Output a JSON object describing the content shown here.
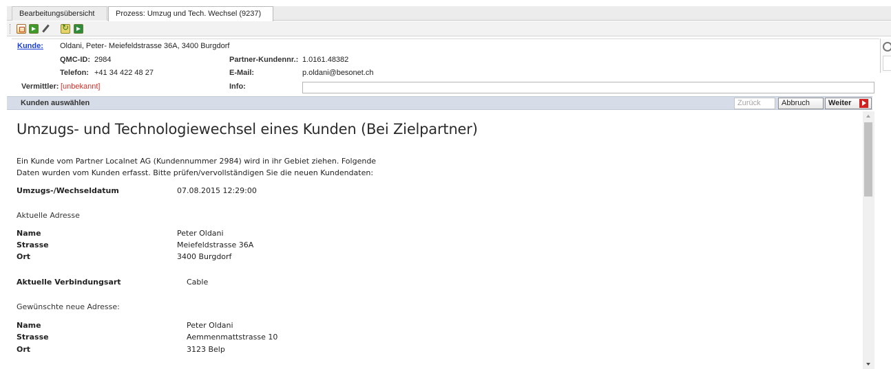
{
  "tabs": [
    {
      "label": "Bearbeitungsübersicht"
    },
    {
      "label": "Prozess: Umzug und Tech. Wechsel (9237)"
    }
  ],
  "toolbar": {
    "icons": [
      "edit-form-icon",
      "import-icon",
      "pencil-icon",
      "refresh-icon",
      "export-icon"
    ]
  },
  "customer": {
    "kunde_label": "Kunde:",
    "kunde_value": "Oldani, Peter- Meiefeldstrasse 36A, 3400 Burgdorf",
    "qmc_label": "QMC-ID:",
    "qmc_value": "2984",
    "telefon_label": "Telefon:",
    "telefon_value": "+41 34 422 48 27",
    "vermittler_label": "Vermittler:",
    "vermittler_value": "[unbekannt]",
    "partner_label": "Partner-Kundennr.:",
    "partner_value": "1.0161.48382",
    "email_label": "E-Mail:",
    "email_value": "p.oldani@besonet.ch",
    "info_label": "Info:",
    "info_value": ""
  },
  "actionbar": {
    "title": "Kunden auswählen",
    "zurueck": "Zurück",
    "abbruch": "Abbruch",
    "weiter": "Weiter"
  },
  "content": {
    "heading": "Umzugs- und Technologiewechsel eines Kunden (Bei Zielpartner)",
    "intro_line1": "Ein Kunde vom Partner Localnet AG (Kundennummer 2984) wird in ihr Gebiet ziehen. Folgende",
    "intro_line2": "Daten wurden vom Kunden erfasst. Bitte prüfen/vervollständigen Sie die neuen Kundendaten:",
    "datum_label": "Umzugs-/Wechseldatum",
    "datum_value": "07.08.2015 12:29:00",
    "current_section": "Aktuelle Adresse",
    "current": {
      "name_label": "Name",
      "name_value": "Peter Oldani",
      "strasse_label": "Strasse",
      "strasse_value": "Meiefeldstrasse 36A",
      "ort_label": "Ort",
      "ort_value": "3400 Burgdorf"
    },
    "verbindung_label": "Aktuelle Verbindungsart",
    "verbindung_value": "Cable",
    "new_section": "Gewünschte neue Adresse:",
    "new": {
      "name_label": "Name",
      "name_value": "Peter Oldani",
      "strasse_label": "Strasse",
      "strasse_value": "Aemmenmattstrasse 10",
      "ort_label": "Ort",
      "ort_value": "3123 Belp"
    }
  }
}
